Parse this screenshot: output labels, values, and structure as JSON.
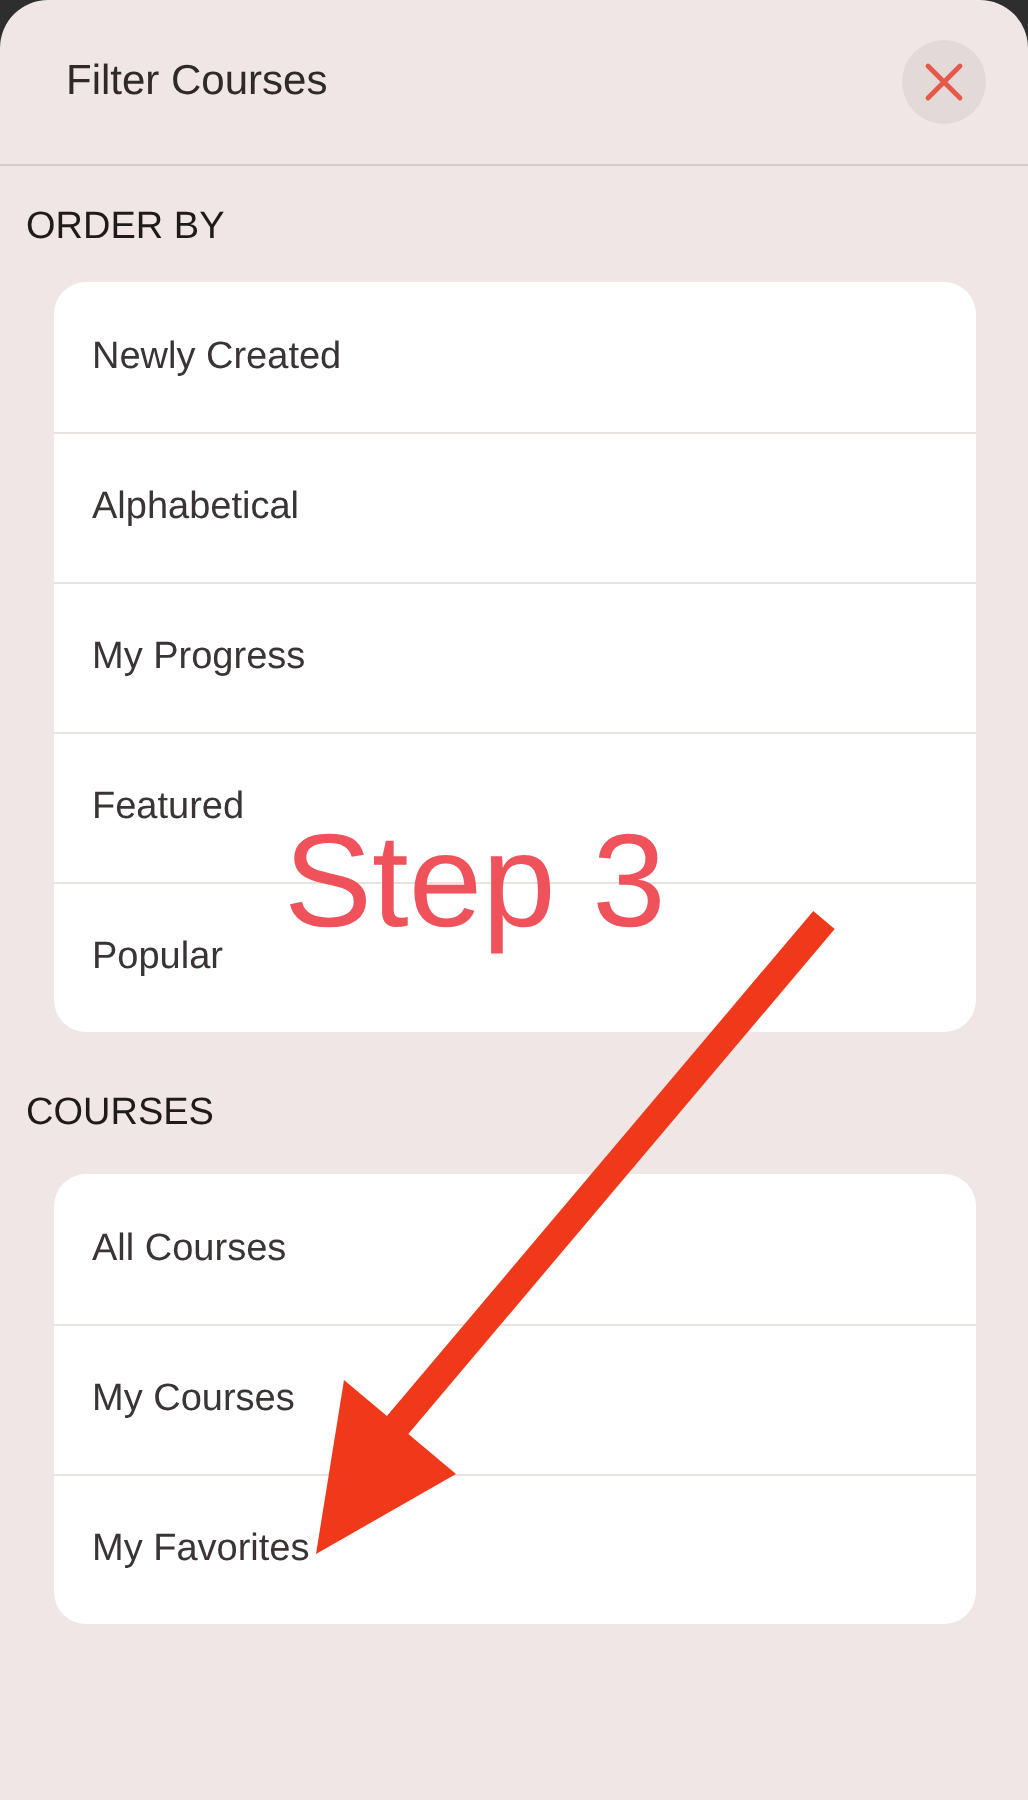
{
  "header": {
    "title": "Filter Courses"
  },
  "sections": [
    {
      "heading": "ORDER BY",
      "items": [
        {
          "label": "Newly Created"
        },
        {
          "label": "Alphabetical"
        },
        {
          "label": "My Progress"
        },
        {
          "label": "Featured"
        },
        {
          "label": "Popular"
        }
      ]
    },
    {
      "heading": "COURSES",
      "items": [
        {
          "label": "All Courses"
        },
        {
          "label": "My Courses"
        },
        {
          "label": "My Favorites"
        }
      ]
    }
  ],
  "annotation": {
    "text": "Step 3"
  }
}
